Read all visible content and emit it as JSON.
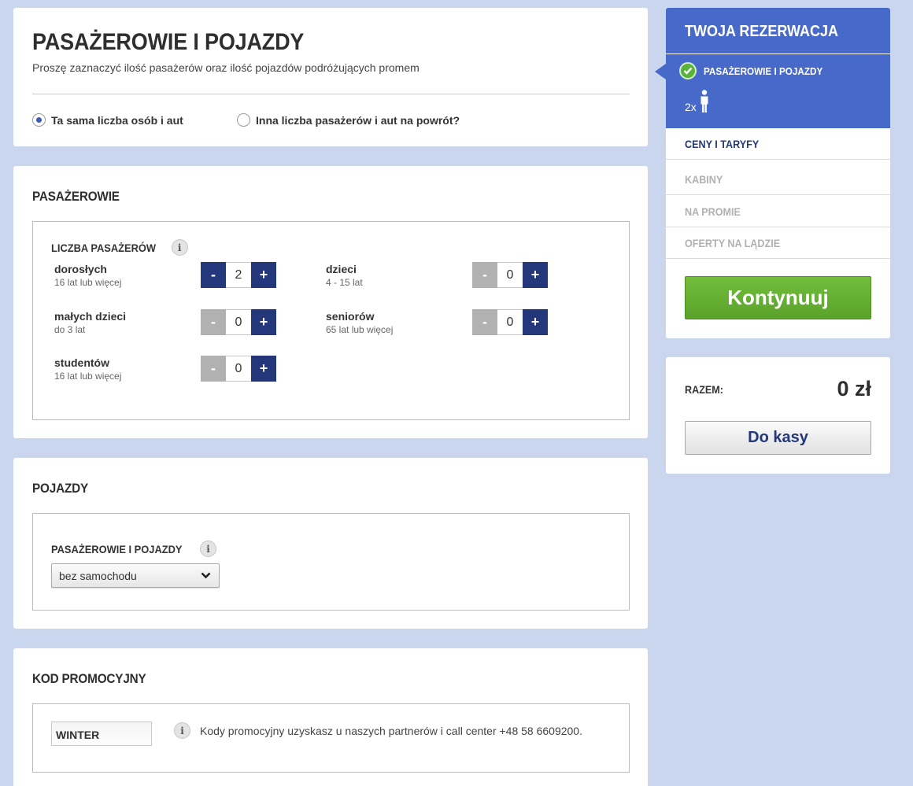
{
  "header": {
    "title": "PASAŻEROWIE I POJAZDY",
    "subtitle": "Proszę zaznaczyć ilość pasażerów oraz ilość pojazdów podróżujących promem"
  },
  "trip_mode": {
    "options": [
      {
        "label": "Ta sama liczba osób i aut",
        "selected": true
      },
      {
        "label": "Inna liczba pasażerów i aut na powrót?",
        "selected": false
      }
    ]
  },
  "passengers": {
    "section_title": "PASAŻEROWIE",
    "count_label": "LICZBA PASAŻERÓW",
    "info_icon": "info-icon",
    "types": [
      {
        "name": "dorosłych",
        "desc": "16 lat lub więcej",
        "value": "2",
        "minus": "-",
        "plus": "+"
      },
      {
        "name": "dzieci",
        "desc": "4 - 15 lat",
        "value": "0",
        "minus": "-",
        "plus": "+"
      },
      {
        "name": "małych dzieci",
        "desc": "do 3 lat",
        "value": "0",
        "minus": "-",
        "plus": "+"
      },
      {
        "name": "seniorów",
        "desc": "65 lat lub więcej",
        "value": "0",
        "minus": "-",
        "plus": "+"
      },
      {
        "name": "studentów",
        "desc": "16 lat lub więcej",
        "value": "0",
        "minus": "-",
        "plus": "+"
      }
    ]
  },
  "vehicles": {
    "section_title": "POJAZDY",
    "label": "PASAŻEROWIE I POJAZDY",
    "selected": "bez samochodu"
  },
  "promo": {
    "section_title": "KOD PROMOCYJNY",
    "code_value": "WINTER",
    "note": "Kody promocyjny uzyskasz u naszych partnerów i call center +48 58 6609200."
  },
  "sidebar": {
    "title": "TWOJA REZERWACJA",
    "active_step": "PASAŻEROWIE I POJAZDY",
    "passenger_count": "2x",
    "steps": [
      "CENY I TARYFY",
      "KABINY",
      "NA PROMIE",
      "OFERTY NA LĄDZIE"
    ],
    "continue_label": "Kontynuuj"
  },
  "total": {
    "label": "RAZEM:",
    "value": "0 zł",
    "checkout_label": "Do kasy"
  },
  "colors": {
    "brand_blue": "#4769c9",
    "navy": "#23377a",
    "green": "#5aa22a",
    "page_bg": "#c9d6ee"
  }
}
